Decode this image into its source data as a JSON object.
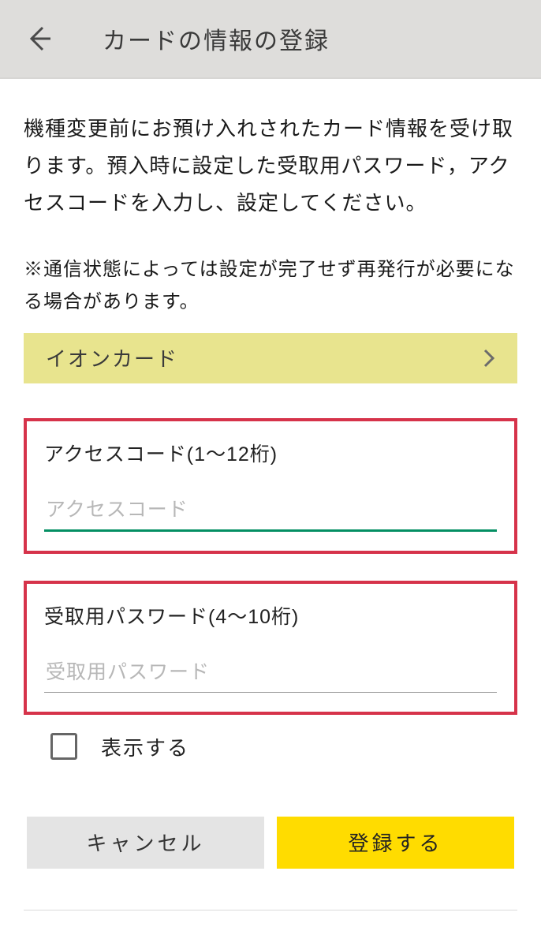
{
  "header": {
    "title": "カードの情報の登録"
  },
  "main": {
    "description": "機種変更前にお預け入れされたカード情報を受け取ります。預入時に設定した受取用パスワード，アクセスコードを入力し、設定してください。",
    "note": "※通信状態によっては設定が完了せず再発行が必要になる場合があります。",
    "card_selector_label": "イオンカード",
    "access_code": {
      "label": "アクセスコード(1〜12桁)",
      "placeholder": "アクセスコード",
      "value": ""
    },
    "password": {
      "label": "受取用パスワード(4〜10桁)",
      "placeholder": "受取用パスワード",
      "value": ""
    },
    "show_password_label": "表示する",
    "show_password_checked": false
  },
  "buttons": {
    "cancel_label": "キャンセル",
    "submit_label": "登録する"
  }
}
